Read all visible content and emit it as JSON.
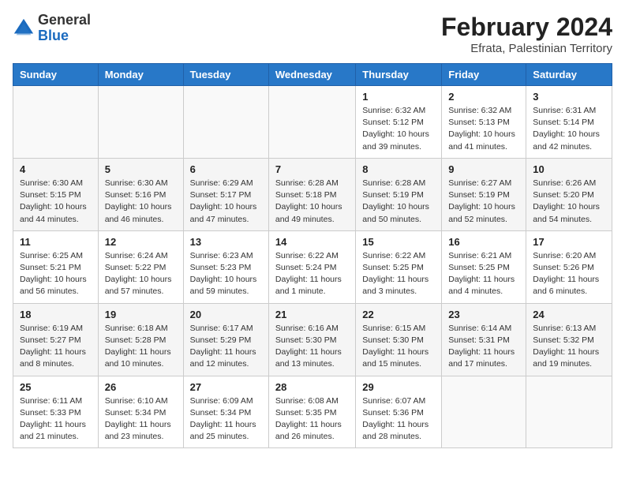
{
  "header": {
    "logo_general": "General",
    "logo_blue": "Blue",
    "month_year": "February 2024",
    "location": "Efrata, Palestinian Territory"
  },
  "days_of_week": [
    "Sunday",
    "Monday",
    "Tuesday",
    "Wednesday",
    "Thursday",
    "Friday",
    "Saturday"
  ],
  "weeks": [
    [
      {
        "day": "",
        "info": ""
      },
      {
        "day": "",
        "info": ""
      },
      {
        "day": "",
        "info": ""
      },
      {
        "day": "",
        "info": ""
      },
      {
        "day": "1",
        "info": "Sunrise: 6:32 AM\nSunset: 5:12 PM\nDaylight: 10 hours and 39 minutes."
      },
      {
        "day": "2",
        "info": "Sunrise: 6:32 AM\nSunset: 5:13 PM\nDaylight: 10 hours and 41 minutes."
      },
      {
        "day": "3",
        "info": "Sunrise: 6:31 AM\nSunset: 5:14 PM\nDaylight: 10 hours and 42 minutes."
      }
    ],
    [
      {
        "day": "4",
        "info": "Sunrise: 6:30 AM\nSunset: 5:15 PM\nDaylight: 10 hours and 44 minutes."
      },
      {
        "day": "5",
        "info": "Sunrise: 6:30 AM\nSunset: 5:16 PM\nDaylight: 10 hours and 46 minutes."
      },
      {
        "day": "6",
        "info": "Sunrise: 6:29 AM\nSunset: 5:17 PM\nDaylight: 10 hours and 47 minutes."
      },
      {
        "day": "7",
        "info": "Sunrise: 6:28 AM\nSunset: 5:18 PM\nDaylight: 10 hours and 49 minutes."
      },
      {
        "day": "8",
        "info": "Sunrise: 6:28 AM\nSunset: 5:19 PM\nDaylight: 10 hours and 50 minutes."
      },
      {
        "day": "9",
        "info": "Sunrise: 6:27 AM\nSunset: 5:19 PM\nDaylight: 10 hours and 52 minutes."
      },
      {
        "day": "10",
        "info": "Sunrise: 6:26 AM\nSunset: 5:20 PM\nDaylight: 10 hours and 54 minutes."
      }
    ],
    [
      {
        "day": "11",
        "info": "Sunrise: 6:25 AM\nSunset: 5:21 PM\nDaylight: 10 hours and 56 minutes."
      },
      {
        "day": "12",
        "info": "Sunrise: 6:24 AM\nSunset: 5:22 PM\nDaylight: 10 hours and 57 minutes."
      },
      {
        "day": "13",
        "info": "Sunrise: 6:23 AM\nSunset: 5:23 PM\nDaylight: 10 hours and 59 minutes."
      },
      {
        "day": "14",
        "info": "Sunrise: 6:22 AM\nSunset: 5:24 PM\nDaylight: 11 hours and 1 minute."
      },
      {
        "day": "15",
        "info": "Sunrise: 6:22 AM\nSunset: 5:25 PM\nDaylight: 11 hours and 3 minutes."
      },
      {
        "day": "16",
        "info": "Sunrise: 6:21 AM\nSunset: 5:25 PM\nDaylight: 11 hours and 4 minutes."
      },
      {
        "day": "17",
        "info": "Sunrise: 6:20 AM\nSunset: 5:26 PM\nDaylight: 11 hours and 6 minutes."
      }
    ],
    [
      {
        "day": "18",
        "info": "Sunrise: 6:19 AM\nSunset: 5:27 PM\nDaylight: 11 hours and 8 minutes."
      },
      {
        "day": "19",
        "info": "Sunrise: 6:18 AM\nSunset: 5:28 PM\nDaylight: 11 hours and 10 minutes."
      },
      {
        "day": "20",
        "info": "Sunrise: 6:17 AM\nSunset: 5:29 PM\nDaylight: 11 hours and 12 minutes."
      },
      {
        "day": "21",
        "info": "Sunrise: 6:16 AM\nSunset: 5:30 PM\nDaylight: 11 hours and 13 minutes."
      },
      {
        "day": "22",
        "info": "Sunrise: 6:15 AM\nSunset: 5:30 PM\nDaylight: 11 hours and 15 minutes."
      },
      {
        "day": "23",
        "info": "Sunrise: 6:14 AM\nSunset: 5:31 PM\nDaylight: 11 hours and 17 minutes."
      },
      {
        "day": "24",
        "info": "Sunrise: 6:13 AM\nSunset: 5:32 PM\nDaylight: 11 hours and 19 minutes."
      }
    ],
    [
      {
        "day": "25",
        "info": "Sunrise: 6:11 AM\nSunset: 5:33 PM\nDaylight: 11 hours and 21 minutes."
      },
      {
        "day": "26",
        "info": "Sunrise: 6:10 AM\nSunset: 5:34 PM\nDaylight: 11 hours and 23 minutes."
      },
      {
        "day": "27",
        "info": "Sunrise: 6:09 AM\nSunset: 5:34 PM\nDaylight: 11 hours and 25 minutes."
      },
      {
        "day": "28",
        "info": "Sunrise: 6:08 AM\nSunset: 5:35 PM\nDaylight: 11 hours and 26 minutes."
      },
      {
        "day": "29",
        "info": "Sunrise: 6:07 AM\nSunset: 5:36 PM\nDaylight: 11 hours and 28 minutes."
      },
      {
        "day": "",
        "info": ""
      },
      {
        "day": "",
        "info": ""
      }
    ]
  ]
}
